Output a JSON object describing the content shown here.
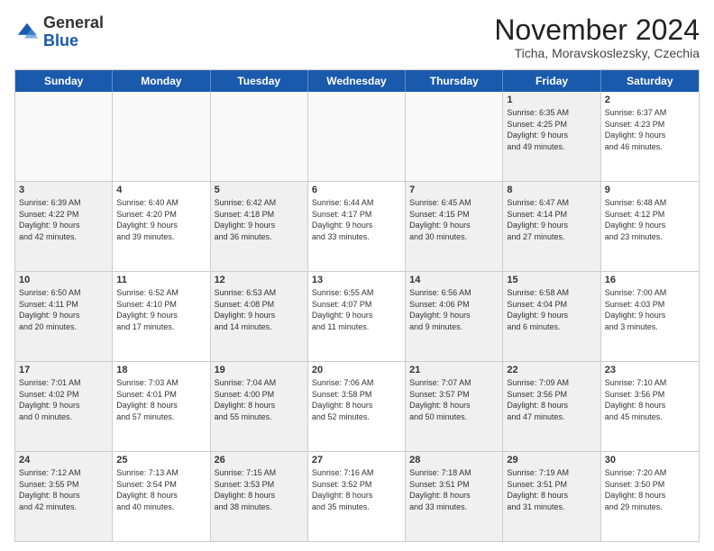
{
  "header": {
    "logo_general": "General",
    "logo_blue": "Blue",
    "month_title": "November 2024",
    "location": "Ticha, Moravskoslezsky, Czechia"
  },
  "calendar": {
    "days_of_week": [
      "Sunday",
      "Monday",
      "Tuesday",
      "Wednesday",
      "Thursday",
      "Friday",
      "Saturday"
    ],
    "rows": [
      {
        "cells": [
          {
            "day": "",
            "info": "",
            "empty": true
          },
          {
            "day": "",
            "info": "",
            "empty": true
          },
          {
            "day": "",
            "info": "",
            "empty": true
          },
          {
            "day": "",
            "info": "",
            "empty": true
          },
          {
            "day": "",
            "info": "",
            "empty": true
          },
          {
            "day": "1",
            "info": "Sunrise: 6:35 AM\nSunset: 4:25 PM\nDaylight: 9 hours\nand 49 minutes.",
            "shaded": true
          },
          {
            "day": "2",
            "info": "Sunrise: 6:37 AM\nSunset: 4:23 PM\nDaylight: 9 hours\nand 46 minutes.",
            "shaded": false
          }
        ]
      },
      {
        "cells": [
          {
            "day": "3",
            "info": "Sunrise: 6:39 AM\nSunset: 4:22 PM\nDaylight: 9 hours\nand 42 minutes.",
            "shaded": true
          },
          {
            "day": "4",
            "info": "Sunrise: 6:40 AM\nSunset: 4:20 PM\nDaylight: 9 hours\nand 39 minutes.",
            "shaded": false
          },
          {
            "day": "5",
            "info": "Sunrise: 6:42 AM\nSunset: 4:18 PM\nDaylight: 9 hours\nand 36 minutes.",
            "shaded": true
          },
          {
            "day": "6",
            "info": "Sunrise: 6:44 AM\nSunset: 4:17 PM\nDaylight: 9 hours\nand 33 minutes.",
            "shaded": false
          },
          {
            "day": "7",
            "info": "Sunrise: 6:45 AM\nSunset: 4:15 PM\nDaylight: 9 hours\nand 30 minutes.",
            "shaded": true
          },
          {
            "day": "8",
            "info": "Sunrise: 6:47 AM\nSunset: 4:14 PM\nDaylight: 9 hours\nand 27 minutes.",
            "shaded": true
          },
          {
            "day": "9",
            "info": "Sunrise: 6:48 AM\nSunset: 4:12 PM\nDaylight: 9 hours\nand 23 minutes.",
            "shaded": false
          }
        ]
      },
      {
        "cells": [
          {
            "day": "10",
            "info": "Sunrise: 6:50 AM\nSunset: 4:11 PM\nDaylight: 9 hours\nand 20 minutes.",
            "shaded": true
          },
          {
            "day": "11",
            "info": "Sunrise: 6:52 AM\nSunset: 4:10 PM\nDaylight: 9 hours\nand 17 minutes.",
            "shaded": false
          },
          {
            "day": "12",
            "info": "Sunrise: 6:53 AM\nSunset: 4:08 PM\nDaylight: 9 hours\nand 14 minutes.",
            "shaded": true
          },
          {
            "day": "13",
            "info": "Sunrise: 6:55 AM\nSunset: 4:07 PM\nDaylight: 9 hours\nand 11 minutes.",
            "shaded": false
          },
          {
            "day": "14",
            "info": "Sunrise: 6:56 AM\nSunset: 4:06 PM\nDaylight: 9 hours\nand 9 minutes.",
            "shaded": true
          },
          {
            "day": "15",
            "info": "Sunrise: 6:58 AM\nSunset: 4:04 PM\nDaylight: 9 hours\nand 6 minutes.",
            "shaded": true
          },
          {
            "day": "16",
            "info": "Sunrise: 7:00 AM\nSunset: 4:03 PM\nDaylight: 9 hours\nand 3 minutes.",
            "shaded": false
          }
        ]
      },
      {
        "cells": [
          {
            "day": "17",
            "info": "Sunrise: 7:01 AM\nSunset: 4:02 PM\nDaylight: 9 hours\nand 0 minutes.",
            "shaded": true
          },
          {
            "day": "18",
            "info": "Sunrise: 7:03 AM\nSunset: 4:01 PM\nDaylight: 8 hours\nand 57 minutes.",
            "shaded": false
          },
          {
            "day": "19",
            "info": "Sunrise: 7:04 AM\nSunset: 4:00 PM\nDaylight: 8 hours\nand 55 minutes.",
            "shaded": true
          },
          {
            "day": "20",
            "info": "Sunrise: 7:06 AM\nSunset: 3:58 PM\nDaylight: 8 hours\nand 52 minutes.",
            "shaded": false
          },
          {
            "day": "21",
            "info": "Sunrise: 7:07 AM\nSunset: 3:57 PM\nDaylight: 8 hours\nand 50 minutes.",
            "shaded": true
          },
          {
            "day": "22",
            "info": "Sunrise: 7:09 AM\nSunset: 3:56 PM\nDaylight: 8 hours\nand 47 minutes.",
            "shaded": true
          },
          {
            "day": "23",
            "info": "Sunrise: 7:10 AM\nSunset: 3:56 PM\nDaylight: 8 hours\nand 45 minutes.",
            "shaded": false
          }
        ]
      },
      {
        "cells": [
          {
            "day": "24",
            "info": "Sunrise: 7:12 AM\nSunset: 3:55 PM\nDaylight: 8 hours\nand 42 minutes.",
            "shaded": true
          },
          {
            "day": "25",
            "info": "Sunrise: 7:13 AM\nSunset: 3:54 PM\nDaylight: 8 hours\nand 40 minutes.",
            "shaded": false
          },
          {
            "day": "26",
            "info": "Sunrise: 7:15 AM\nSunset: 3:53 PM\nDaylight: 8 hours\nand 38 minutes.",
            "shaded": true
          },
          {
            "day": "27",
            "info": "Sunrise: 7:16 AM\nSunset: 3:52 PM\nDaylight: 8 hours\nand 35 minutes.",
            "shaded": false
          },
          {
            "day": "28",
            "info": "Sunrise: 7:18 AM\nSunset: 3:51 PM\nDaylight: 8 hours\nand 33 minutes.",
            "shaded": true
          },
          {
            "day": "29",
            "info": "Sunrise: 7:19 AM\nSunset: 3:51 PM\nDaylight: 8 hours\nand 31 minutes.",
            "shaded": true
          },
          {
            "day": "30",
            "info": "Sunrise: 7:20 AM\nSunset: 3:50 PM\nDaylight: 8 hours\nand 29 minutes.",
            "shaded": false
          }
        ]
      }
    ]
  }
}
